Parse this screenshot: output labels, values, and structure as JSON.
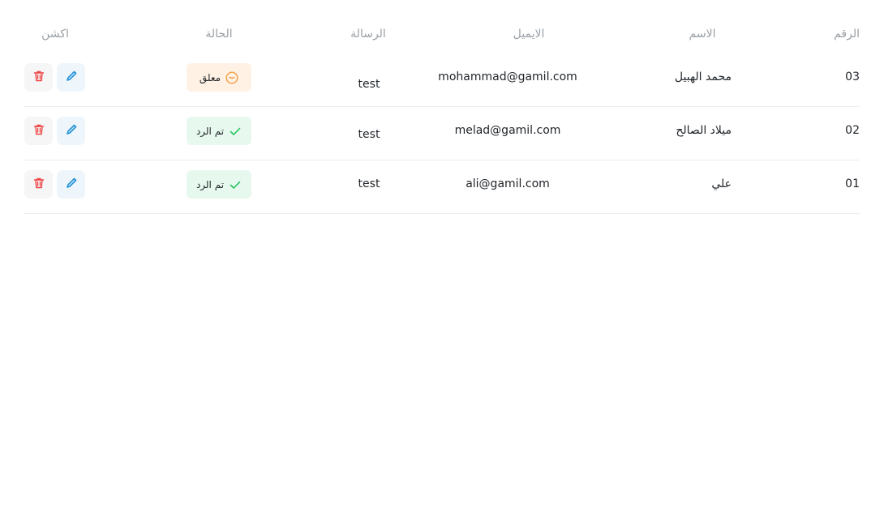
{
  "table": {
    "headers": {
      "id": "الرقم",
      "name": "الاسم",
      "email": "الايميل",
      "message": "الرسالة",
      "status": "الحالة",
      "actions": "اكشن"
    },
    "rows": [
      {
        "id": "03",
        "name": "محمد الهبيل",
        "email": "mohammad@gamil.com",
        "message": "test",
        "status": "معلق",
        "status_type": "pending"
      },
      {
        "id": "02",
        "name": "ميلاد الصالح",
        "email": "melad@gamil.com",
        "message": "test",
        "status": "تم الرد",
        "status_type": "done"
      },
      {
        "id": "01",
        "name": "علي",
        "email": "ali@gamil.com",
        "message": "test",
        "status": "تم الرد",
        "status_type": "done"
      }
    ]
  },
  "icons": {
    "pending": "minus-circle-icon",
    "done": "check-icon",
    "edit": "pencil-icon",
    "delete": "trash-icon"
  },
  "colors": {
    "header_text": "#9aa0a6",
    "pending_bg": "#fff1e4",
    "pending_icon": "#f59e42",
    "done_bg": "#e7f8ee",
    "done_icon": "#22c55e",
    "edit_icon": "#1f8fd6",
    "delete_icon": "#ef4444"
  }
}
